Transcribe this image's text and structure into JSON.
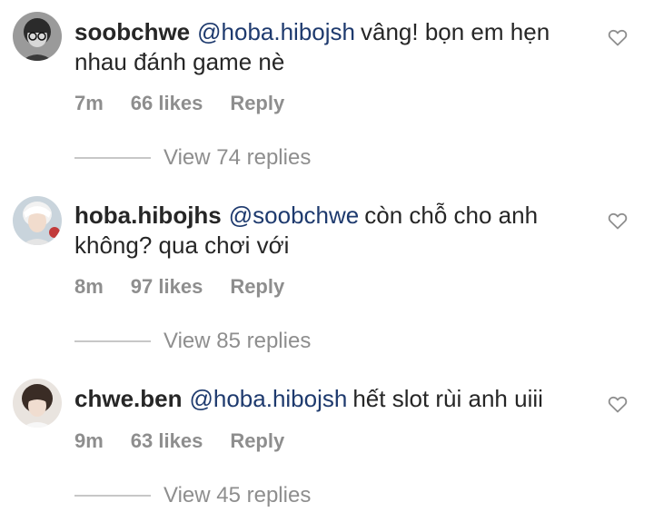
{
  "comments": [
    {
      "username": "soobchwe",
      "mention": "@hoba.hibojsh",
      "text": "vâng! bọn em hẹn nhau đánh game nè",
      "time": "7m",
      "likes": "66 likes",
      "reply_label": "Reply",
      "view_replies": "View 74 replies"
    },
    {
      "username": "hoba.hibojhs",
      "mention": "@soobchwe",
      "text": "còn chỗ cho anh không? qua chơi với",
      "time": "8m",
      "likes": "97 likes",
      "reply_label": "Reply",
      "view_replies": "View 85 replies"
    },
    {
      "username": "chwe.ben",
      "mention": "@hoba.hibojsh",
      "text": "hết slot rùi anh uiii",
      "time": "9m",
      "likes": "63 likes",
      "reply_label": "Reply",
      "view_replies": "View 45 replies"
    }
  ],
  "colors": {
    "text": "#262626",
    "mention": "#1e3a6e",
    "muted": "#8e8e8e",
    "divider": "#c7c7c7"
  },
  "icons": {
    "like": "heart-outline-icon"
  }
}
